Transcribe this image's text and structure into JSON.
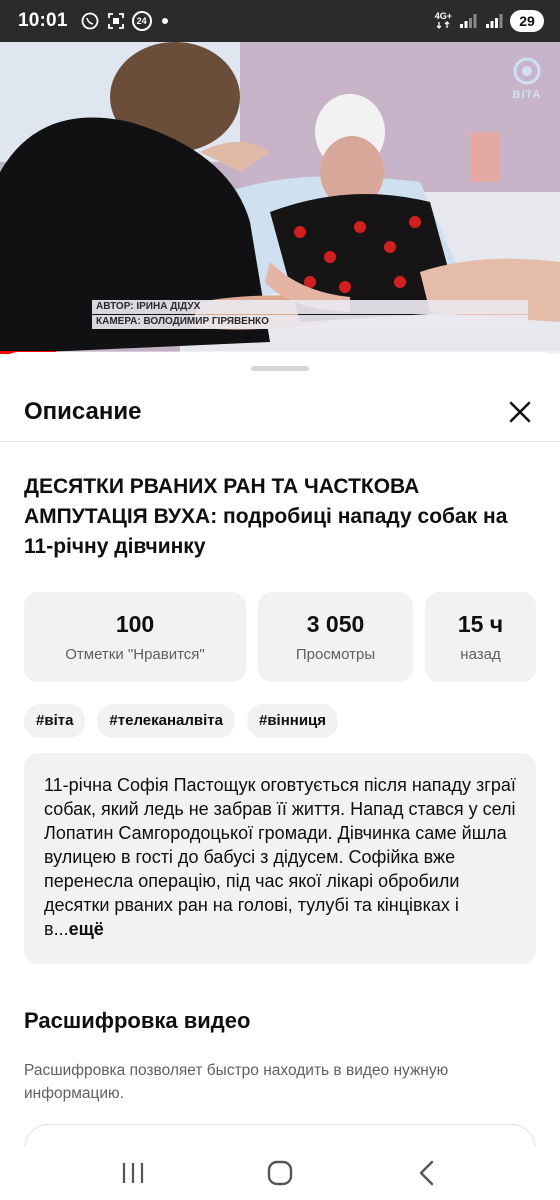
{
  "status_bar": {
    "time": "10:01",
    "notification_badge": "24",
    "network": "4G+",
    "battery": "29"
  },
  "video": {
    "channel_logo_text": "ВІТА",
    "credits": [
      "АВТОР: ІРИНА ДІДУХ",
      "КАМЕРА: ВОЛОДИМИР ГІРЯВЕНКО"
    ],
    "progress": 0.1
  },
  "sheet": {
    "title": "Описание",
    "video_title_bold": "ДЕСЯТКИ РВАНИХ РАН ТА ЧАСТКОВА АМПУТАЦІЯ ВУХА:",
    "video_title_rest": " подробиці нападу собак на 11-річну дівчинку",
    "stats": {
      "likes_value": "100",
      "likes_label": "Отметки \"Нравится\"",
      "views_value": "3 050",
      "views_label": "Просмотры",
      "age_value": "15 ч",
      "age_label": "назад"
    },
    "tags": [
      "#віта",
      "#телеканалвіта",
      "#вінниця"
    ],
    "description": "11-річна Софія Пастощук оговтується після нападу зграї собак, який ледь не забрав її життя. Напад стався у селі Лопатин Самгородоцької громади. Дівчинка саме йшла вулицею в гості до бабусі з дідусем. Софійка вже перенесла операцію, під час якої лікарі обробили десятки рваних ран на голові, тулубі та кінцівках і в...",
    "more_label": "ещё",
    "transcript_title": "Расшифровка видео",
    "transcript_desc": "Расшифровка позволяет быстро находить в видео нужную информацию."
  },
  "colors": {
    "accent_progress": "#ff0000",
    "chip_bg": "#f2f2f2",
    "secondary_text": "#606060"
  }
}
